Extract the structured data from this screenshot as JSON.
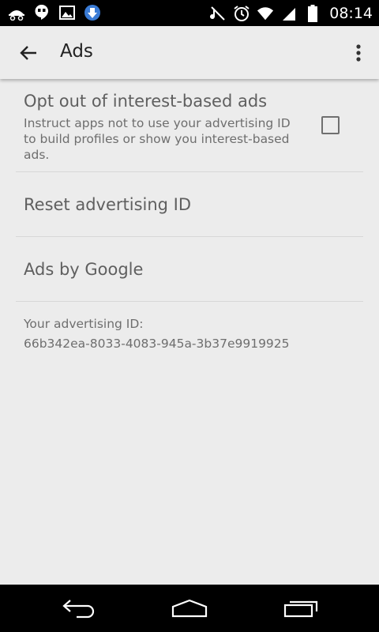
{
  "status_bar": {
    "time": "08:14",
    "left_icons": [
      "incognito-icon",
      "hangouts-icon",
      "image-icon",
      "download-icon"
    ],
    "right_icons": [
      "mute-icon",
      "alarm-icon",
      "wifi-icon",
      "signal-icon",
      "battery-icon"
    ]
  },
  "action_bar": {
    "title": "Ads"
  },
  "settings": {
    "opt_out": {
      "title": "Opt out of interest-based ads",
      "summary": "Instruct apps not to use your advertising ID to build profiles or show you interest-based ads.",
      "checked": false
    },
    "reset": {
      "title": "Reset advertising ID"
    },
    "ads_by_google": {
      "title": "Ads by Google"
    },
    "advertising_id": {
      "label": "Your advertising ID:",
      "value": "66b342ea-8033-4083-945a-3b37e9919925"
    }
  },
  "colors": {
    "background": "#ececec",
    "status_bar": "#000000",
    "text_primary": "#5f5f5f",
    "text_secondary": "#6e6e6e"
  }
}
